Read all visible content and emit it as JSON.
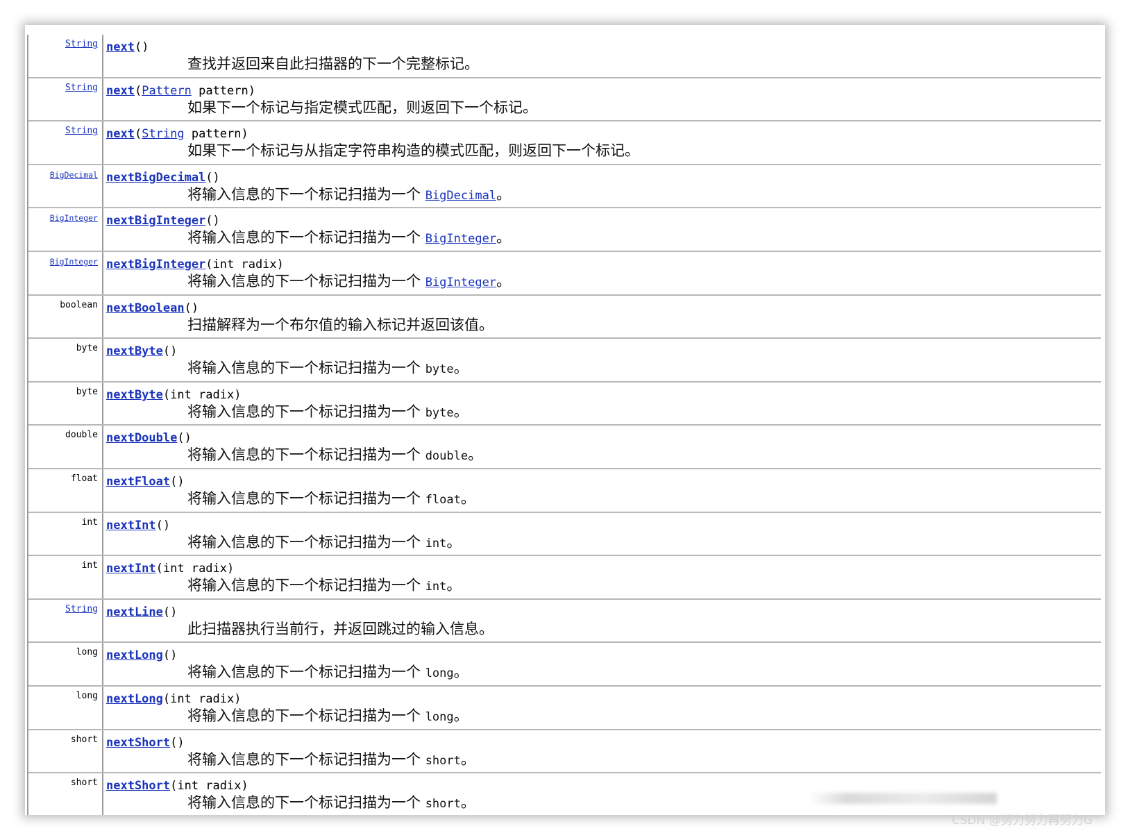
{
  "methods": [
    {
      "type": "String",
      "type_link": true,
      "name": "next",
      "params": [
        {
          "t": "()"
        }
      ],
      "desc": [
        {
          "t": "查找并返回来自此扫描器的下一个完整标记。"
        }
      ]
    },
    {
      "type": "String",
      "type_link": true,
      "name": "next",
      "params": [
        {
          "t": "("
        },
        {
          "t": "Pattern",
          "link": true
        },
        {
          "t": " pattern)"
        }
      ],
      "desc": [
        {
          "t": "如果下一个标记与指定模式匹配，则返回下一个标记。"
        }
      ]
    },
    {
      "type": "String",
      "type_link": true,
      "name": "next",
      "params": [
        {
          "t": "("
        },
        {
          "t": "String",
          "link": true
        },
        {
          "t": " pattern)"
        }
      ],
      "desc": [
        {
          "t": "如果下一个标记与从指定字符串构造的模式匹配，则返回下一个标记。"
        }
      ]
    },
    {
      "type": "BigDecimal",
      "type_link": true,
      "name": "nextBigDecimal",
      "params": [
        {
          "t": "()"
        }
      ],
      "desc": [
        {
          "t": "将输入信息的下一个标记扫描为一个 "
        },
        {
          "t": "BigDecimal",
          "code": true,
          "link": true
        },
        {
          "t": "。"
        }
      ]
    },
    {
      "type": "BigInteger",
      "type_link": true,
      "name": "nextBigInteger",
      "params": [
        {
          "t": "()"
        }
      ],
      "desc": [
        {
          "t": "将输入信息的下一个标记扫描为一个 "
        },
        {
          "t": "BigInteger",
          "code": true,
          "link": true
        },
        {
          "t": "。"
        }
      ]
    },
    {
      "type": "BigInteger",
      "type_link": true,
      "name": "nextBigInteger",
      "params": [
        {
          "t": "(int radix)"
        }
      ],
      "desc": [
        {
          "t": "将输入信息的下一个标记扫描为一个 "
        },
        {
          "t": "BigInteger",
          "code": true,
          "link": true
        },
        {
          "t": "。"
        }
      ]
    },
    {
      "type": "boolean",
      "type_link": false,
      "name": "nextBoolean",
      "params": [
        {
          "t": "()"
        }
      ],
      "desc": [
        {
          "t": "扫描解释为一个布尔值的输入标记并返回该值。"
        }
      ]
    },
    {
      "type": "byte",
      "type_link": false,
      "name": "nextByte",
      "params": [
        {
          "t": "()"
        }
      ],
      "desc": [
        {
          "t": "将输入信息的下一个标记扫描为一个 "
        },
        {
          "t": "byte",
          "code": true
        },
        {
          "t": "。"
        }
      ]
    },
    {
      "type": "byte",
      "type_link": false,
      "name": "nextByte",
      "params": [
        {
          "t": "(int radix)"
        }
      ],
      "desc": [
        {
          "t": "将输入信息的下一个标记扫描为一个 "
        },
        {
          "t": "byte",
          "code": true
        },
        {
          "t": "。"
        }
      ]
    },
    {
      "type": "double",
      "type_link": false,
      "name": "nextDouble",
      "params": [
        {
          "t": "()"
        }
      ],
      "desc": [
        {
          "t": "将输入信息的下一个标记扫描为一个 "
        },
        {
          "t": "double",
          "code": true
        },
        {
          "t": "。"
        }
      ]
    },
    {
      "type": "float",
      "type_link": false,
      "name": "nextFloat",
      "params": [
        {
          "t": "()"
        }
      ],
      "desc": [
        {
          "t": "将输入信息的下一个标记扫描为一个 "
        },
        {
          "t": "float",
          "code": true
        },
        {
          "t": "。"
        }
      ]
    },
    {
      "type": "int",
      "type_link": false,
      "name": "nextInt",
      "params": [
        {
          "t": "()"
        }
      ],
      "desc": [
        {
          "t": "将输入信息的下一个标记扫描为一个 "
        },
        {
          "t": "int",
          "code": true
        },
        {
          "t": "。"
        }
      ]
    },
    {
      "type": "int",
      "type_link": false,
      "name": "nextInt",
      "params": [
        {
          "t": "(int radix)"
        }
      ],
      "desc": [
        {
          "t": "将输入信息的下一个标记扫描为一个 "
        },
        {
          "t": "int",
          "code": true
        },
        {
          "t": "。"
        }
      ]
    },
    {
      "type": "String",
      "type_link": true,
      "name": "nextLine",
      "params": [
        {
          "t": "()"
        }
      ],
      "desc": [
        {
          "t": "此扫描器执行当前行，并返回跳过的输入信息。"
        }
      ]
    },
    {
      "type": "long",
      "type_link": false,
      "name": "nextLong",
      "params": [
        {
          "t": "()"
        }
      ],
      "desc": [
        {
          "t": "将输入信息的下一个标记扫描为一个 "
        },
        {
          "t": "long",
          "code": true
        },
        {
          "t": "。"
        }
      ]
    },
    {
      "type": "long",
      "type_link": false,
      "name": "nextLong",
      "params": [
        {
          "t": "(int radix)"
        }
      ],
      "desc": [
        {
          "t": "将输入信息的下一个标记扫描为一个 "
        },
        {
          "t": "long",
          "code": true
        },
        {
          "t": "。"
        }
      ]
    },
    {
      "type": "short",
      "type_link": false,
      "name": "nextShort",
      "params": [
        {
          "t": "()"
        }
      ],
      "desc": [
        {
          "t": "将输入信息的下一个标记扫描为一个 "
        },
        {
          "t": "short",
          "code": true
        },
        {
          "t": "。"
        }
      ]
    },
    {
      "type": "short",
      "type_link": false,
      "name": "nextShort",
      "params": [
        {
          "t": "(int radix)"
        }
      ],
      "desc": [
        {
          "t": "将输入信息的下一个标记扫描为一个 "
        },
        {
          "t": "short",
          "code": true
        },
        {
          "t": "。"
        }
      ]
    }
  ],
  "watermark": "CSDN @努力努力再努力G",
  "colors": {
    "link": "#1a33bb",
    "border": "#b8b8b8"
  }
}
